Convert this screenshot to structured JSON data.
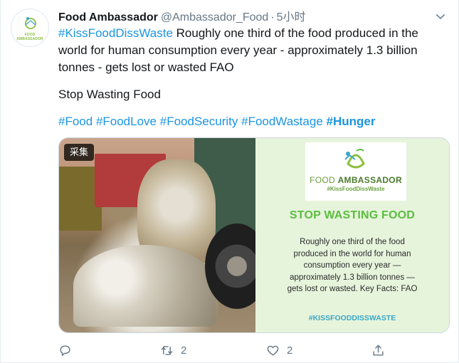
{
  "user": {
    "display_name": "Food Ambassador",
    "handle": "@Ambassador_Food",
    "separator": "·",
    "time": "5小时",
    "avatar_text": "FOOD AMBASSADOR"
  },
  "tweet": {
    "hashtag_main": "#KissFoodDissWaste",
    "text_main": " Roughly one third of the food produced in the world for human consumption every year - approximately 1.3 billion tonnes - gets lost or wasted FAO",
    "text_second": "Stop Wasting Food",
    "hashtags": [
      "#Food",
      "#FoodLove",
      "#FoodSecurity",
      "#FoodWastage",
      "#Hunger"
    ]
  },
  "media": {
    "photo_tag": "采集",
    "card": {
      "brand_light": "FOOD ",
      "brand_bold": "AMBASSADOR",
      "brand_hashtag": "#KissFoodDissWaste",
      "title": "STOP WASTING FOOD",
      "body": "Roughly one third of the food produced in the world for human consumption every year — approximately 1.3 billion tonnes — gets lost or wasted. Key Facts: FAO",
      "hashtag": "#KISSFOODDISSWASTE"
    }
  },
  "actions": {
    "reply_count": "",
    "retweet_count": "2",
    "like_count": "2",
    "share_count": ""
  },
  "icons": {
    "reply": "reply-icon",
    "retweet": "retweet-icon",
    "like": "heart-icon",
    "share": "share-icon",
    "caret": "chevron-down-icon"
  },
  "colors": {
    "link": "#1b95e0",
    "muted": "#657786",
    "card_bg": "#e6f4dc",
    "card_title": "#5bbd3e"
  }
}
